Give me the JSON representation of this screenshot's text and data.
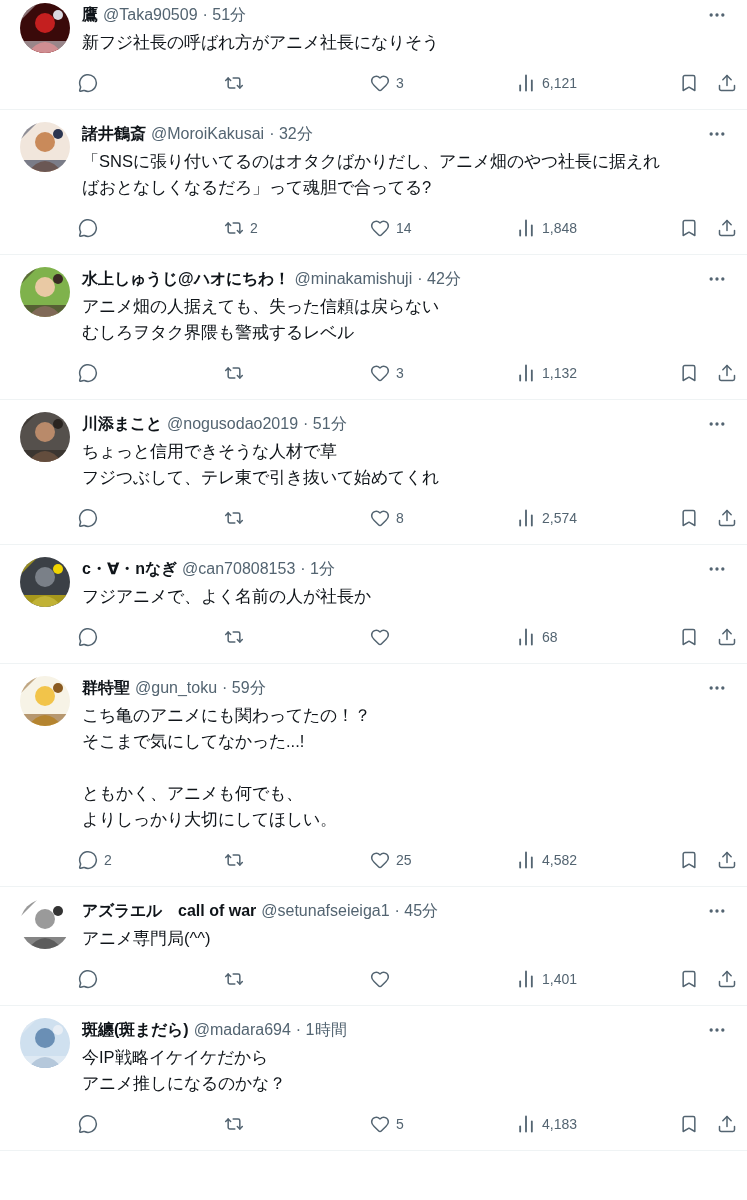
{
  "tweets": [
    {
      "name": "鷹",
      "handle": "@Taka90509",
      "time": "· 51分",
      "paragraphs": [
        [
          "新フジ社長の呼ばれ方がアニメ社長になりそう"
        ]
      ],
      "likes": "3",
      "views": "6,121"
    },
    {
      "name": "諸井鶴斎",
      "handle": "@MoroiKakusai",
      "time": "· 32分",
      "paragraphs": [
        [
          "「SNSに張り付いてるのはオタクばかりだし、アニメ畑のやつ社長に据えれ",
          "ばおとなしくなるだろ」って魂胆で合ってる?"
        ]
      ],
      "retweets": "2",
      "likes": "14",
      "views": "1,848"
    },
    {
      "name": "水上しゅうじ@ハオにちわ！",
      "handle": "@minakamishuji",
      "time": "· 42分",
      "paragraphs": [
        [
          "アニメ畑の人据えても、失った信頼は戻らない",
          "むしろヲタク界隈も警戒するレベル"
        ]
      ],
      "likes": "3",
      "views": "1,132"
    },
    {
      "name": "川添まこと",
      "handle": "@nogusodao2019",
      "time": "· 51分",
      "paragraphs": [
        [
          "ちょっと信用できそうな人材で草",
          "フジつぶして、テレ東で引き抜いて始めてくれ"
        ]
      ],
      "likes": "8",
      "views": "2,574"
    },
    {
      "name": "c・∀・nなぎ",
      "handle": "@can70808153",
      "time": "· 1分",
      "paragraphs": [
        [
          "フジアニメで、よく名前の人が社長か"
        ]
      ],
      "views": "68"
    },
    {
      "name": "群特聖",
      "handle": "@gun_toku",
      "time": "· 59分",
      "paragraphs": [
        [
          "こち亀のアニメにも関わってたの！？",
          "そこまで気にしてなかった...!"
        ],
        [
          "ともかく、アニメも何でも、",
          "よりしっかり大切にしてほしい。"
        ]
      ],
      "replies": "2",
      "likes": "25",
      "views": "4,582"
    },
    {
      "name": "アズラエル　call of war",
      "handle": "@setunafseieiga1",
      "time": "· 45分",
      "paragraphs": [
        [
          "アニメ専門局(^^)"
        ]
      ],
      "views": "1,401"
    },
    {
      "name": "斑纏(斑まだら)",
      "handle": "@madara694",
      "time": "· 1時間",
      "paragraphs": [
        [
          "今IP戦略イケイケだから",
          "アニメ推しになるのかな？"
        ]
      ],
      "likes": "5",
      "views": "4,183"
    }
  ]
}
